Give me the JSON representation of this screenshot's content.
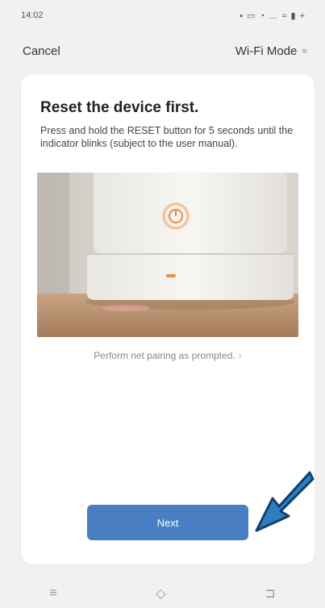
{
  "status_bar": {
    "time": "14:02",
    "icons": "▪ ▭ ◔ … ≈ ▮ +"
  },
  "nav": {
    "cancel": "Cancel",
    "mode": "Wi-Fi Mode",
    "mode_icon": "≈"
  },
  "card": {
    "title": "Reset the device first.",
    "description": "Press and hold the RESET button for 5 seconds until the indicator blinks (subject to the user manual).",
    "hint": "Perform net pairing as prompted.",
    "hint_chevron": "›",
    "next_label": "Next"
  },
  "bottom_nav": {
    "menu": "≡",
    "home": "◇",
    "back": "⊐"
  },
  "colors": {
    "primary": "#4a7ec2",
    "arrow": "#2f7fc0",
    "indicator": "#f08a3c"
  }
}
